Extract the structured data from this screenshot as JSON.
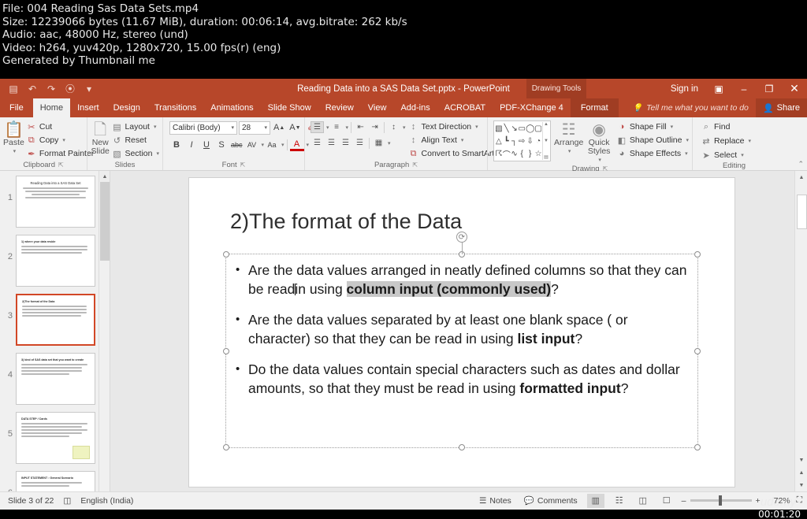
{
  "video_info": {
    "lines": [
      "File: 004 Reading Sas Data Sets.mp4",
      "Size: 12239066 bytes (11.67 MiB), duration: 00:06:14, avg.bitrate: 262 kb/s",
      "Audio: aac, 48000 Hz, stereo (und)",
      "Video: h264, yuv420p, 1280x720, 15.00 fps(r) (eng)",
      "Generated by Thumbnail me"
    ]
  },
  "timestamp": "00:01:20",
  "colors": {
    "ribbon": "#b7472a",
    "contextual_tab": "#a03d23",
    "selection_border": "#d24726",
    "highlight": "#c8c8c8"
  },
  "titlebar": {
    "document_title": "Reading Data into a SAS Data Set.pptx - PowerPoint",
    "contextual_tools": "Drawing Tools",
    "sign_in": "Sign in",
    "quick_access": [
      {
        "name": "save-button",
        "glyph": "▤"
      },
      {
        "name": "undo-button",
        "glyph": "↶"
      },
      {
        "name": "redo-button",
        "glyph": "↷"
      },
      {
        "name": "start-presentation-button",
        "glyph": "⦿"
      },
      {
        "name": "customize-qat-button",
        "glyph": "▾"
      }
    ],
    "ribbon_display_options": "▣",
    "minimize": "–",
    "restore": "❐",
    "close": "✕"
  },
  "tabs": [
    {
      "label": "File",
      "active": false,
      "kind": "file"
    },
    {
      "label": "Home",
      "active": true,
      "kind": "normal"
    },
    {
      "label": "Insert",
      "active": false,
      "kind": "normal"
    },
    {
      "label": "Design",
      "active": false,
      "kind": "normal"
    },
    {
      "label": "Transitions",
      "active": false,
      "kind": "normal"
    },
    {
      "label": "Animations",
      "active": false,
      "kind": "normal"
    },
    {
      "label": "Slide Show",
      "active": false,
      "kind": "normal"
    },
    {
      "label": "Review",
      "active": false,
      "kind": "normal"
    },
    {
      "label": "View",
      "active": false,
      "kind": "normal"
    },
    {
      "label": "Add-ins",
      "active": false,
      "kind": "normal"
    },
    {
      "label": "ACROBAT",
      "active": false,
      "kind": "normal"
    },
    {
      "label": "PDF-XChange 4",
      "active": false,
      "kind": "normal"
    },
    {
      "label": "Format",
      "active": false,
      "kind": "contextual"
    }
  ],
  "tell_me": {
    "placeholder": "Tell me what you want to do"
  },
  "share": {
    "label": "Share"
  },
  "ribbon": {
    "clipboard": {
      "group_label": "Clipboard",
      "paste_label": "Paste",
      "items": [
        {
          "label": "Cut",
          "glyph": "✂"
        },
        {
          "label": "Copy",
          "glyph": "⧉"
        },
        {
          "label": "Format Painter",
          "glyph": "✒"
        }
      ]
    },
    "slides": {
      "group_label": "Slides",
      "new_slide_label": "New Slide",
      "items": [
        {
          "label": "Layout",
          "glyph": "▤"
        },
        {
          "label": "Reset",
          "glyph": "↺"
        },
        {
          "label": "Section",
          "glyph": "▧"
        }
      ]
    },
    "font": {
      "group_label": "Font",
      "font_name": "Calibri (Body)",
      "font_size": "28",
      "grow_font": "A",
      "shrink_font": "A",
      "clear_formatting": "✐",
      "bold": "B",
      "italic": "I",
      "underline": "U",
      "shadow": "S",
      "strikethrough": "abc",
      "character_spacing": "AV",
      "change_case": "Aa",
      "font_color": "A"
    },
    "paragraph": {
      "group_label": "Paragraph",
      "bullets": "☰",
      "numbering": "≡",
      "decrease_indent": "⇤",
      "increase_indent": "⇥",
      "line_spacing": "↕",
      "align_left": "☰",
      "align_center": "☰",
      "align_right": "☰",
      "justify": "☰",
      "columns": "▦",
      "items": [
        {
          "label": "Text Direction",
          "glyph": "↕"
        },
        {
          "label": "Align Text",
          "glyph": "↕"
        },
        {
          "label": "Convert to SmartArt",
          "glyph": "⧉"
        }
      ]
    },
    "drawing": {
      "group_label": "Drawing",
      "shapes": [
        "▧",
        "╲",
        "↘",
        "▭",
        "◯",
        "▢",
        "△",
        "┗",
        "┐",
        "⇨",
        "⇩",
        "◔",
        "☈",
        "⌒",
        "∿",
        "{",
        "}",
        "☆"
      ],
      "arrange_label": "Arrange",
      "quick_styles_label": "Quick Styles",
      "items": [
        {
          "label": "Shape Fill",
          "glyph": "◑"
        },
        {
          "label": "Shape Outline",
          "glyph": "◧"
        },
        {
          "label": "Shape Effects",
          "glyph": "◕"
        }
      ]
    },
    "editing": {
      "group_label": "Editing",
      "items": [
        {
          "label": "Find",
          "glyph": "⌕"
        },
        {
          "label": "Replace",
          "glyph": "⇄"
        },
        {
          "label": "Select",
          "glyph": "➤"
        }
      ]
    },
    "collapse_ribbon": "⌃"
  },
  "thumbnails": [
    {
      "number": "1",
      "title": "Reading Data into a SAS Data Set",
      "selected": false,
      "centered": true,
      "lines": [
        "lg",
        "md",
        "sh",
        "md"
      ],
      "has_box": false
    },
    {
      "number": "2",
      "title": "1) where your data reside",
      "selected": false,
      "centered": false,
      "lines": [
        "lg",
        "lg",
        "md"
      ],
      "has_box": false
    },
    {
      "number": "3",
      "title": "2)The format of the Data",
      "selected": true,
      "centered": false,
      "lines": [
        "lg",
        "lg",
        "lg"
      ],
      "has_box": false
    },
    {
      "number": "4",
      "title": "3) kind of SAS data set that you want to create",
      "selected": false,
      "centered": false,
      "lines": [
        "lg",
        "md",
        "md",
        "sh"
      ],
      "has_box": false
    },
    {
      "number": "5",
      "title": "DATA STEP / Cards",
      "selected": false,
      "centered": false,
      "lines": [
        "lg",
        "md",
        "lg",
        "md",
        "sh"
      ],
      "has_box": true
    },
    {
      "number": "6",
      "title": "INPUT STATEMENT : General Scenario",
      "selected": false,
      "centered": false,
      "lines": [
        "md",
        "sh"
      ],
      "has_box": false
    }
  ],
  "slide": {
    "title": "2)The format of the Data",
    "bullets": [
      {
        "marker": "•",
        "segments": [
          {
            "text": "Are the data values arranged in neatly defined columns so that they can be read",
            "style": "normal"
          },
          {
            "text": "│",
            "style": "caret"
          },
          {
            "text": "in using ",
            "style": "normal"
          },
          {
            "text": "column input (commonly used)",
            "style": "bold-highlight"
          },
          {
            "text": "?",
            "style": "normal"
          }
        ]
      },
      {
        "marker": "•",
        "segments": [
          {
            "text": " Are the data values separated by at least one blank space ( or character) so that they can be read in using ",
            "style": "normal"
          },
          {
            "text": "list input",
            "style": "bold"
          },
          {
            "text": "?",
            "style": "normal"
          }
        ]
      },
      {
        "marker": "•",
        "segments": [
          {
            "text": "Do the data values contain special characters such as dates and dollar amounts, so that they must be read in using ",
            "style": "normal"
          },
          {
            "text": "formatted input",
            "style": "bold"
          },
          {
            "text": "?",
            "style": "normal"
          }
        ]
      }
    ]
  },
  "statusbar": {
    "slide_indicator": "Slide 3 of 22",
    "language": "English (India)",
    "spellcheck_icon": "◫",
    "notes_label": "Notes",
    "comments_label": "Comments",
    "views": [
      {
        "name": "normal-view-button",
        "glyph": "▥",
        "active": true
      },
      {
        "name": "slide-sorter-button",
        "glyph": "☷",
        "active": false
      },
      {
        "name": "reading-view-button",
        "glyph": "◫",
        "active": false
      },
      {
        "name": "slideshow-button",
        "glyph": "☐",
        "active": false
      }
    ],
    "zoom_out": "–",
    "zoom_in": "+",
    "zoom_level": "72%",
    "fit_to_window": "⛶"
  }
}
